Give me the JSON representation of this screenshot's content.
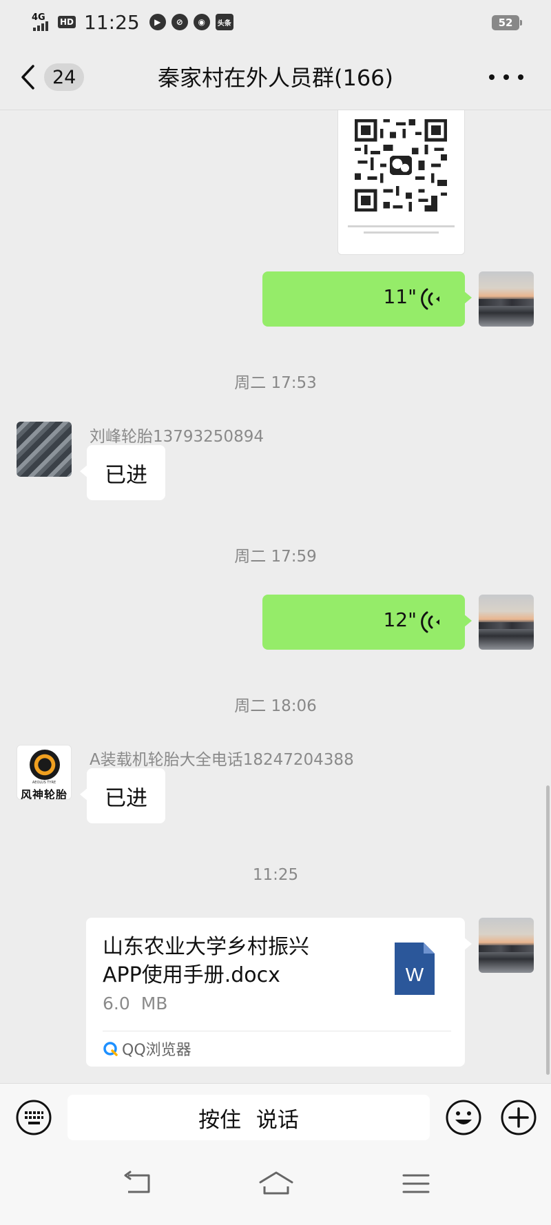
{
  "status_bar": {
    "network": "4G",
    "hd": "HD",
    "time": "11:25",
    "news_app": "头条",
    "battery": "52"
  },
  "header": {
    "unread_count": "24",
    "title": "秦家村在外人员群(166)"
  },
  "messages": [
    {
      "type": "image",
      "from": "me",
      "icon": "qr-code"
    },
    {
      "type": "voice",
      "from": "me",
      "duration": "11\""
    },
    {
      "type": "time",
      "text": "周二  17:53"
    },
    {
      "type": "text",
      "from": "other",
      "sender": "刘峰轮胎13793250894",
      "text": "已进"
    },
    {
      "type": "time",
      "text": "周二  17:59"
    },
    {
      "type": "voice",
      "from": "me",
      "duration": "12\""
    },
    {
      "type": "time",
      "text": "周二  18:06"
    },
    {
      "type": "text",
      "from": "other",
      "sender": "A装载机轮胎大全电话18247204388",
      "text": "已进",
      "avatar_text": "风神轮胎",
      "avatar_subtext": "AEOLUS TYRE"
    },
    {
      "type": "time",
      "text": "11:25"
    },
    {
      "type": "file",
      "from": "me",
      "file_name": "山东农业大学乡村振兴APP使用手册.docx",
      "file_size": "6.0  MB",
      "file_icon_letter": "W",
      "source": "QQ浏览器"
    }
  ],
  "input_bar": {
    "talk_label": "按住  说话"
  },
  "colors": {
    "background": "#ededed",
    "my_bubble": "#95ec69",
    "other_bubble": "#ffffff",
    "word_icon": "#2b579a"
  }
}
